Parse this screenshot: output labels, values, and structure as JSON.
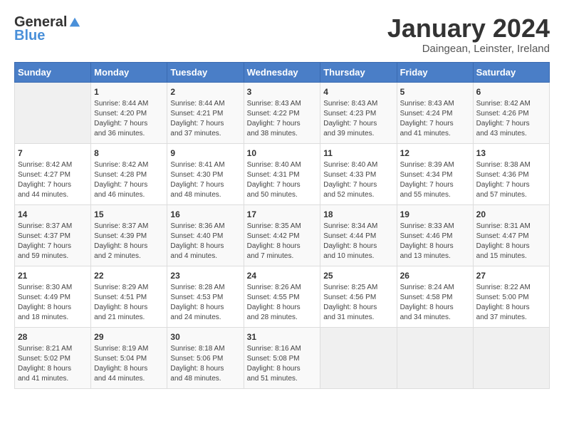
{
  "header": {
    "logo_general": "General",
    "logo_blue": "Blue",
    "month_title": "January 2024",
    "subtitle": "Daingean, Leinster, Ireland"
  },
  "weekdays": [
    "Sunday",
    "Monday",
    "Tuesday",
    "Wednesday",
    "Thursday",
    "Friday",
    "Saturday"
  ],
  "weeks": [
    [
      {
        "day": "",
        "info": ""
      },
      {
        "day": "1",
        "info": "Sunrise: 8:44 AM\nSunset: 4:20 PM\nDaylight: 7 hours\nand 36 minutes."
      },
      {
        "day": "2",
        "info": "Sunrise: 8:44 AM\nSunset: 4:21 PM\nDaylight: 7 hours\nand 37 minutes."
      },
      {
        "day": "3",
        "info": "Sunrise: 8:43 AM\nSunset: 4:22 PM\nDaylight: 7 hours\nand 38 minutes."
      },
      {
        "day": "4",
        "info": "Sunrise: 8:43 AM\nSunset: 4:23 PM\nDaylight: 7 hours\nand 39 minutes."
      },
      {
        "day": "5",
        "info": "Sunrise: 8:43 AM\nSunset: 4:24 PM\nDaylight: 7 hours\nand 41 minutes."
      },
      {
        "day": "6",
        "info": "Sunrise: 8:42 AM\nSunset: 4:26 PM\nDaylight: 7 hours\nand 43 minutes."
      }
    ],
    [
      {
        "day": "7",
        "info": "Sunrise: 8:42 AM\nSunset: 4:27 PM\nDaylight: 7 hours\nand 44 minutes."
      },
      {
        "day": "8",
        "info": "Sunrise: 8:42 AM\nSunset: 4:28 PM\nDaylight: 7 hours\nand 46 minutes."
      },
      {
        "day": "9",
        "info": "Sunrise: 8:41 AM\nSunset: 4:30 PM\nDaylight: 7 hours\nand 48 minutes."
      },
      {
        "day": "10",
        "info": "Sunrise: 8:40 AM\nSunset: 4:31 PM\nDaylight: 7 hours\nand 50 minutes."
      },
      {
        "day": "11",
        "info": "Sunrise: 8:40 AM\nSunset: 4:33 PM\nDaylight: 7 hours\nand 52 minutes."
      },
      {
        "day": "12",
        "info": "Sunrise: 8:39 AM\nSunset: 4:34 PM\nDaylight: 7 hours\nand 55 minutes."
      },
      {
        "day": "13",
        "info": "Sunrise: 8:38 AM\nSunset: 4:36 PM\nDaylight: 7 hours\nand 57 minutes."
      }
    ],
    [
      {
        "day": "14",
        "info": "Sunrise: 8:37 AM\nSunset: 4:37 PM\nDaylight: 7 hours\nand 59 minutes."
      },
      {
        "day": "15",
        "info": "Sunrise: 8:37 AM\nSunset: 4:39 PM\nDaylight: 8 hours\nand 2 minutes."
      },
      {
        "day": "16",
        "info": "Sunrise: 8:36 AM\nSunset: 4:40 PM\nDaylight: 8 hours\nand 4 minutes."
      },
      {
        "day": "17",
        "info": "Sunrise: 8:35 AM\nSunset: 4:42 PM\nDaylight: 8 hours\nand 7 minutes."
      },
      {
        "day": "18",
        "info": "Sunrise: 8:34 AM\nSunset: 4:44 PM\nDaylight: 8 hours\nand 10 minutes."
      },
      {
        "day": "19",
        "info": "Sunrise: 8:33 AM\nSunset: 4:46 PM\nDaylight: 8 hours\nand 13 minutes."
      },
      {
        "day": "20",
        "info": "Sunrise: 8:31 AM\nSunset: 4:47 PM\nDaylight: 8 hours\nand 15 minutes."
      }
    ],
    [
      {
        "day": "21",
        "info": "Sunrise: 8:30 AM\nSunset: 4:49 PM\nDaylight: 8 hours\nand 18 minutes."
      },
      {
        "day": "22",
        "info": "Sunrise: 8:29 AM\nSunset: 4:51 PM\nDaylight: 8 hours\nand 21 minutes."
      },
      {
        "day": "23",
        "info": "Sunrise: 8:28 AM\nSunset: 4:53 PM\nDaylight: 8 hours\nand 24 minutes."
      },
      {
        "day": "24",
        "info": "Sunrise: 8:26 AM\nSunset: 4:55 PM\nDaylight: 8 hours\nand 28 minutes."
      },
      {
        "day": "25",
        "info": "Sunrise: 8:25 AM\nSunset: 4:56 PM\nDaylight: 8 hours\nand 31 minutes."
      },
      {
        "day": "26",
        "info": "Sunrise: 8:24 AM\nSunset: 4:58 PM\nDaylight: 8 hours\nand 34 minutes."
      },
      {
        "day": "27",
        "info": "Sunrise: 8:22 AM\nSunset: 5:00 PM\nDaylight: 8 hours\nand 37 minutes."
      }
    ],
    [
      {
        "day": "28",
        "info": "Sunrise: 8:21 AM\nSunset: 5:02 PM\nDaylight: 8 hours\nand 41 minutes."
      },
      {
        "day": "29",
        "info": "Sunrise: 8:19 AM\nSunset: 5:04 PM\nDaylight: 8 hours\nand 44 minutes."
      },
      {
        "day": "30",
        "info": "Sunrise: 8:18 AM\nSunset: 5:06 PM\nDaylight: 8 hours\nand 48 minutes."
      },
      {
        "day": "31",
        "info": "Sunrise: 8:16 AM\nSunset: 5:08 PM\nDaylight: 8 hours\nand 51 minutes."
      },
      {
        "day": "",
        "info": ""
      },
      {
        "day": "",
        "info": ""
      },
      {
        "day": "",
        "info": ""
      }
    ]
  ]
}
